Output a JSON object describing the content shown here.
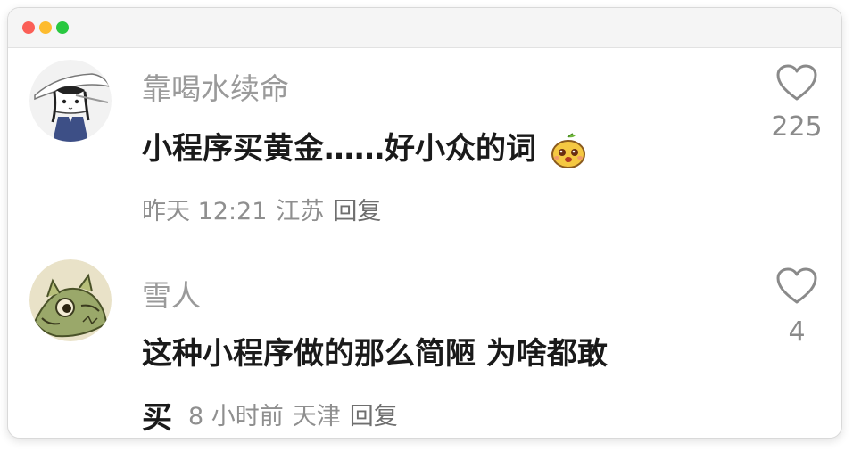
{
  "window": {
    "controls": [
      "close",
      "minimize",
      "maximize"
    ]
  },
  "comments": [
    {
      "username": "靠喝水续命",
      "text": "小程序买黄金……好小众的词",
      "emoji": "cute-chestnut-emoji",
      "time": "昨天 12:21",
      "location": "江苏",
      "reply_label": "回复",
      "likes": "225",
      "avatar": "anime-girl-sketch-avatar"
    },
    {
      "username": "雪人",
      "text_line1": "这种小程序做的那么简陋 为啥都敢",
      "text_line2": "买",
      "time": "8 小时前",
      "location": "天津",
      "reply_label": "回复",
      "likes": "4",
      "avatar": "green-dragon-avatar"
    }
  ]
}
